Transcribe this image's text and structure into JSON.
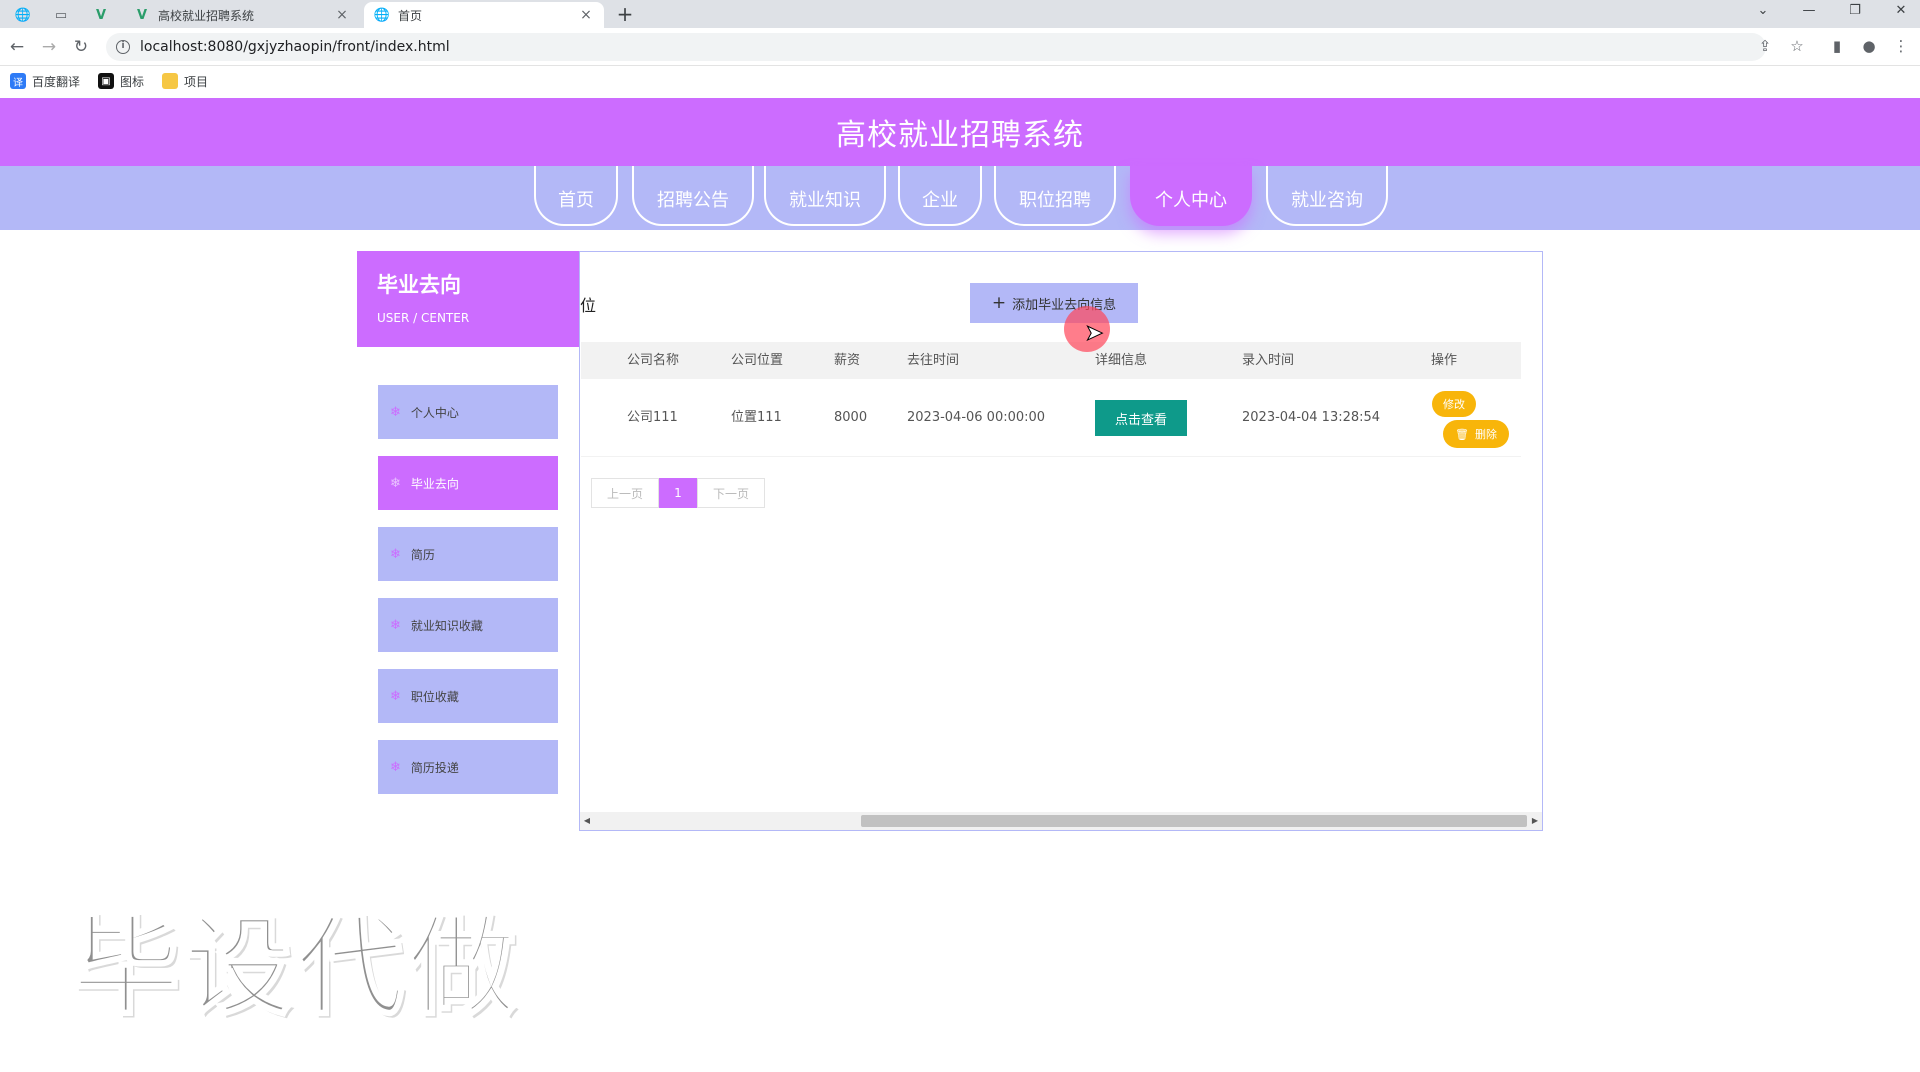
{
  "browser": {
    "tabs": [
      {
        "title": "高校就业招聘系统",
        "active": false
      },
      {
        "title": "首页",
        "active": true
      }
    ],
    "url": "localhost:8080/gxjyzhaopin/front/index.html",
    "bookmarks": [
      {
        "label": "百度翻译"
      },
      {
        "label": "图标"
      },
      {
        "label": "项目"
      }
    ]
  },
  "site": {
    "title": "高校就业招聘系统",
    "nav": [
      {
        "label": "首页",
        "active": false
      },
      {
        "label": "招聘公告",
        "active": false
      },
      {
        "label": "就业知识",
        "active": false
      },
      {
        "label": "企业",
        "active": false
      },
      {
        "label": "职位招聘",
        "active": false
      },
      {
        "label": "个人中心",
        "active": true
      },
      {
        "label": "就业咨询",
        "active": false
      }
    ]
  },
  "sidebar": {
    "title": "毕业去向",
    "subtitle": "USER / CENTER",
    "items": [
      {
        "label": "个人中心",
        "active": false
      },
      {
        "label": "毕业去向",
        "active": true
      },
      {
        "label": "简历",
        "active": false
      },
      {
        "label": "就业知识收藏",
        "active": false
      },
      {
        "label": "职位收藏",
        "active": false
      },
      {
        "label": "简历投递",
        "active": false
      }
    ]
  },
  "main": {
    "stray_text": "位",
    "add_button": "添加毕业去向信息",
    "columns": [
      "公司名称",
      "公司位置",
      "薪资",
      "去往时间",
      "详细信息",
      "录入时间",
      "操作"
    ],
    "rows": [
      {
        "company": "公司111",
        "location": "位置111",
        "salary": "8000",
        "go_time": "2023-04-06 00:00:00",
        "detail_button": "点击查看",
        "entry_time": "2023-04-04 13:28:54",
        "edit_button": "修改",
        "delete_button": "删除"
      }
    ],
    "pager": {
      "prev": "上一页",
      "current": "1",
      "next": "下一页"
    }
  },
  "watermark": "毕设代做",
  "colors": {
    "primary": "#cc6cff",
    "secondary": "#b3b8f7",
    "detail_button": "#0e9a8a",
    "action_button": "#f8b50a"
  }
}
